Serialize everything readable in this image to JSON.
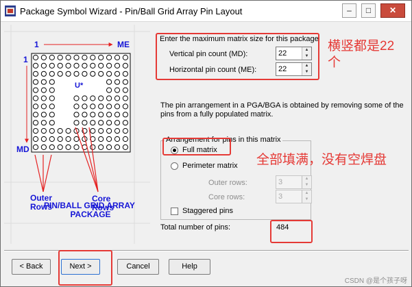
{
  "window": {
    "title": "Package Symbol Wizard - Pin/Ball Grid Array Pin Layout"
  },
  "diagram": {
    "top_left_index": "1",
    "top_right_label": "ME",
    "left_index": "1",
    "bottom_left_label": "MD",
    "pin_marker": "U*",
    "outer_label": "Outer\nRows",
    "core_label": "Core\nRows",
    "caption": "PIN/BALL GRID ARRAY\nPACKAGE",
    "colors": {
      "blue": "#1515d6",
      "red": "#e52121"
    }
  },
  "matrix": {
    "heading": "Enter the maximum matrix size for this package",
    "vertical_label": "Vertical pin count (MD):",
    "vertical_value": "22",
    "horizontal_label": "Horizontal pin count (ME):",
    "horizontal_value": "22"
  },
  "description": "The pin arrangement in a PGA/BGA is obtained by removing some of the pins from a fully populated matrix.",
  "arrangement": {
    "group_title": "Arrangement for pins in this matrix",
    "full_matrix": "Full matrix",
    "perimeter_matrix": "Perimeter matrix",
    "outer_rows_label": "Outer rows:",
    "outer_rows_value": "3",
    "core_rows_label": "Core rows:",
    "core_rows_value": "3",
    "staggered": "Staggered pins"
  },
  "total": {
    "label": "Total number of pins:",
    "value": "484"
  },
  "buttons": {
    "back": "< Back",
    "next": "Next >",
    "cancel": "Cancel",
    "help": "Help"
  },
  "annotations": {
    "size_note": "横竖都是22\n个",
    "full_note": "全部填满，没有空焊盘"
  },
  "watermark": "CSDN @是个孩子呀"
}
